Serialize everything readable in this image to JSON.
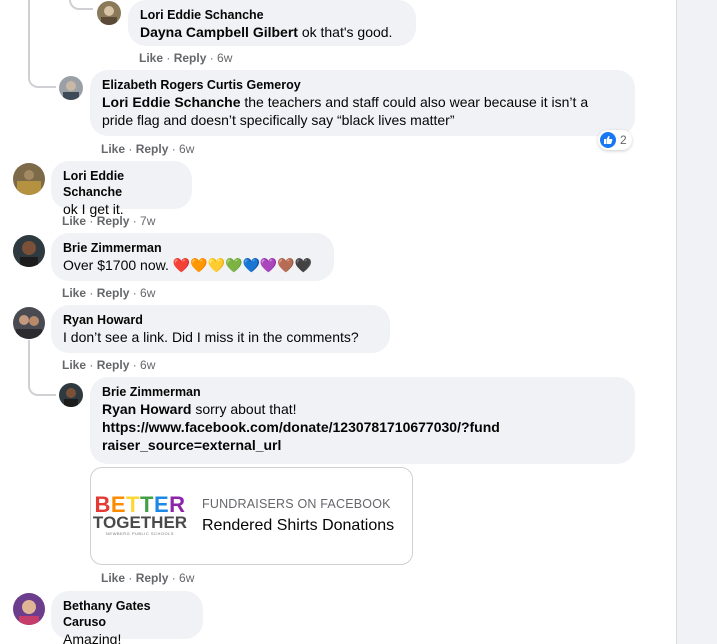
{
  "comments": [
    {
      "author": "Lori Eddie Schanche",
      "mention": "Dayna Campbell Gilbert",
      "text": " ok that's good.",
      "like": "Like",
      "reply": "Reply",
      "age": "6w"
    },
    {
      "author": "Elizabeth Rogers Curtis Gemeroy",
      "mention": "Lori Eddie Schanche",
      "text": " the teachers and staff could also wear because it isn’t a pride flag and doesn’t specifically say “black lives matter”",
      "like": "Like",
      "reply": "Reply",
      "age": "6w",
      "reaction_count": "2"
    },
    {
      "author": "Lori Eddie Schanche",
      "text": "ok I get it.",
      "like": "Like",
      "reply": "Reply",
      "age": "7w"
    },
    {
      "author": "Brie Zimmerman",
      "text": "Over $1700 now. ",
      "hearts": "❤️🧡💛💚💙💜🤎🖤",
      "like": "Like",
      "reply": "Reply",
      "age": "6w"
    },
    {
      "author": "Ryan Howard",
      "text": "I don’t see a link. Did I miss it in the comments?",
      "like": "Like",
      "reply": "Reply",
      "age": "6w"
    },
    {
      "author": "Brie Zimmerman",
      "mention": "Ryan Howard",
      "text": " sorry about that!",
      "link": "https://www.facebook.com/donate/1230781710677030/?fundraiser_source=external_url",
      "like": "Like",
      "reply": "Reply",
      "age": "6w"
    },
    {
      "author": "Bethany Gates Caruso",
      "text": "Amazing!"
    }
  ],
  "card": {
    "logo_line1": "BETTER",
    "logo_line2": "TOGETHER",
    "logo_line3": "NEWBERG PUBLIC SCHOOLS",
    "source": "FUNDRAISERS ON FACEBOOK",
    "title": "Rendered Shirts Donations"
  },
  "colors": {
    "bubble": "#f0f2f5",
    "meta_text": "#65676b",
    "like_blue": "#1877f2"
  },
  "icons": [
    "like-reaction-icon"
  ]
}
